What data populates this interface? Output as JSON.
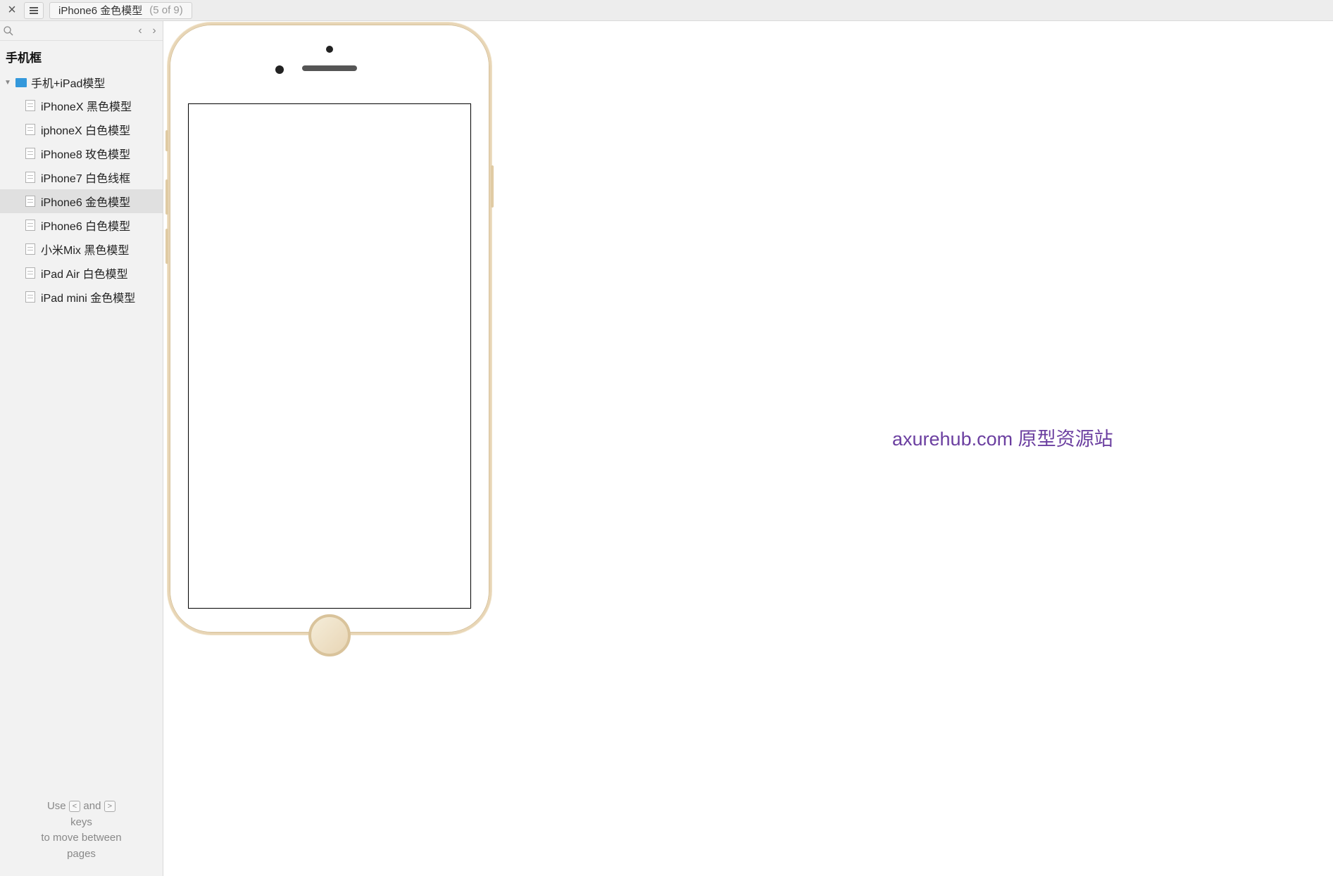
{
  "topbar": {
    "title": "iPhone6 金色模型",
    "counter": "(5 of 9)"
  },
  "sidebar": {
    "title": "手机框",
    "folder": "手机+iPad模型",
    "items": [
      {
        "label": "iPhoneX 黑色模型",
        "selected": false
      },
      {
        "label": "iphoneX 白色模型",
        "selected": false
      },
      {
        "label": "iPhone8 玫色模型",
        "selected": false
      },
      {
        "label": "iPhone7 白色线框",
        "selected": false
      },
      {
        "label": "iPhone6 金色模型",
        "selected": true
      },
      {
        "label": "iPhone6 白色模型",
        "selected": false
      },
      {
        "label": "小米Mix 黑色模型",
        "selected": false
      },
      {
        "label": "iPad Air 白色模型",
        "selected": false
      },
      {
        "label": "iPad mini 金色模型",
        "selected": false
      }
    ],
    "hint_use": "Use",
    "hint_and": "and",
    "hint_keys": "keys",
    "hint_move": "to move between",
    "hint_pages": "pages",
    "key_prev": "<",
    "key_next": ">"
  },
  "watermark": "axurehub.com 原型资源站"
}
